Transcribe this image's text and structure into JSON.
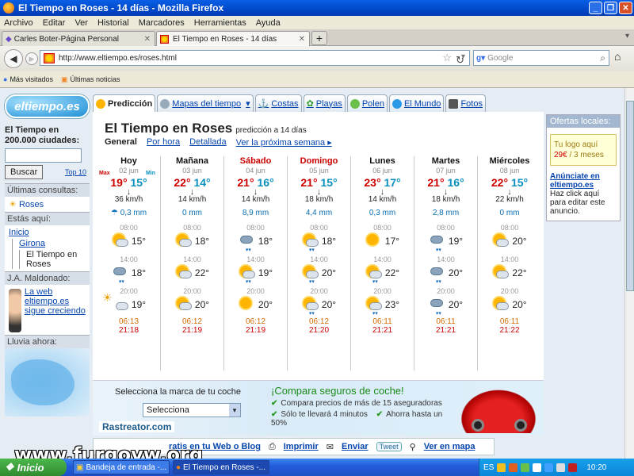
{
  "window": {
    "title": "El Tiempo en Roses - 14 días - Mozilla Firefox"
  },
  "menu": [
    "Archivo",
    "Editar",
    "Ver",
    "Historial",
    "Marcadores",
    "Herramientas",
    "Ayuda"
  ],
  "tabs": [
    {
      "label": "Carles Boter-Página Personal"
    },
    {
      "label": "El Tiempo en Roses - 14 días"
    }
  ],
  "url": "http://www.eltiempo.es/roses.html",
  "search": {
    "placeholder": "Google"
  },
  "bookmarks": [
    "Más visitados",
    "Últimas noticias"
  ],
  "left": {
    "logo": "eltiempo.es",
    "search_title": "El Tiempo en 200.000 ciudades:",
    "search_button": "Buscar",
    "top10": "Top 10",
    "recent_title": "Últimas consultas:",
    "recent_item": "Roses",
    "here_title": "Estás aquí:",
    "crumbs": [
      "Inicio",
      "Girona",
      "El Tiempo en Roses"
    ],
    "author_title": "J.A. Maldonado:",
    "author_link": "La web eltiempo.es sigue creciendo",
    "rain_title": "Lluvia ahora:"
  },
  "site_tabs": [
    "Predicción",
    "Mapas del tiempo",
    "Costas",
    "Playas",
    "Polen",
    "El Mundo",
    "Fotos"
  ],
  "heading": {
    "title": "El Tiempo en Roses",
    "sub": "predicción a 14 días"
  },
  "subnav": {
    "current": "General",
    "links": [
      "Por hora",
      "Detallada",
      "Ver la próxima semana ▸"
    ]
  },
  "labels": {
    "max": "Max",
    "min": "Min"
  },
  "days": [
    {
      "name": "Hoy",
      "date": "02 jun",
      "max": "19°",
      "min": "15°",
      "wind": "36 km/h",
      "rain": "0,3 mm",
      "slots": [
        {
          "time": "08:00",
          "temp": "15°",
          "icon": "sun-cloud-icon"
        },
        {
          "time": "14:00",
          "temp": "18°",
          "icon": "rain-cloud-icon"
        },
        {
          "time": "20:00",
          "temp": "19°",
          "icon": "cloud-icon"
        }
      ],
      "sunrise": "06:13",
      "sunset": "21:18"
    },
    {
      "name": "Mañana",
      "date": "03 jun",
      "max": "22°",
      "min": "14°",
      "wind": "14 km/h",
      "rain": "0 mm",
      "slots": [
        {
          "time": "08:00",
          "temp": "18°",
          "icon": "sun-cloud-icon"
        },
        {
          "time": "14:00",
          "temp": "22°",
          "icon": "sun-cloud-icon"
        },
        {
          "time": "20:00",
          "temp": "20°",
          "icon": "sun-cloud-icon"
        }
      ],
      "sunrise": "06:12",
      "sunset": "21:19"
    },
    {
      "name": "Sábado",
      "date": "04 jun",
      "max": "21°",
      "min": "16°",
      "wind": "14 km/h",
      "rain": "8,9 mm",
      "slots": [
        {
          "time": "08:00",
          "temp": "18°",
          "icon": "rain-cloud-icon"
        },
        {
          "time": "14:00",
          "temp": "19°",
          "icon": "sun-rain-icon"
        },
        {
          "time": "20:00",
          "temp": "20°",
          "icon": "sun-icon"
        }
      ],
      "sunrise": "06:12",
      "sunset": "21:19",
      "red": true
    },
    {
      "name": "Domingo",
      "date": "05 jun",
      "max": "21°",
      "min": "15°",
      "wind": "18 km/h",
      "rain": "4,4 mm",
      "slots": [
        {
          "time": "08:00",
          "temp": "18°",
          "icon": "sun-rain-icon"
        },
        {
          "time": "14:00",
          "temp": "20°",
          "icon": "sun-rain-icon"
        },
        {
          "time": "20:00",
          "temp": "20°",
          "icon": "sun-rain-icon"
        }
      ],
      "sunrise": "06:12",
      "sunset": "21:20",
      "red": true
    },
    {
      "name": "Lunes",
      "date": "06 jun",
      "max": "23°",
      "min": "17°",
      "wind": "14 km/h",
      "rain": "0,3 mm",
      "slots": [
        {
          "time": "08:00",
          "temp": "17°",
          "icon": "sun-icon"
        },
        {
          "time": "14:00",
          "temp": "22°",
          "icon": "sun-rain-icon"
        },
        {
          "time": "20:00",
          "temp": "23°",
          "icon": "sun-rain-icon"
        }
      ],
      "sunrise": "06:11",
      "sunset": "21:21"
    },
    {
      "name": "Martes",
      "date": "07 jun",
      "max": "21°",
      "min": "16°",
      "wind": "18 km/h",
      "rain": "2,8 mm",
      "slots": [
        {
          "time": "08:00",
          "temp": "19°",
          "icon": "rain-cloud-icon"
        },
        {
          "time": "14:00",
          "temp": "20°",
          "icon": "rain-cloud-icon"
        },
        {
          "time": "20:00",
          "temp": "20°",
          "icon": "rain-cloud-icon"
        }
      ],
      "sunrise": "06:11",
      "sunset": "21:21"
    },
    {
      "name": "Miércoles",
      "date": "08 jun",
      "max": "22°",
      "min": "15°",
      "wind": "22 km/h",
      "rain": "0 mm",
      "slots": [
        {
          "time": "08:00",
          "temp": "20°",
          "icon": "sun-cloud-icon"
        },
        {
          "time": "14:00",
          "temp": "22°",
          "icon": "sun-cloud-icon"
        },
        {
          "time": "20:00",
          "temp": "20°",
          "icon": "sun-cloud-icon"
        }
      ],
      "sunrise": "06:11",
      "sunset": "21:22"
    }
  ],
  "ad": {
    "select_title": "Selecciona la marca de tu coche",
    "select_value": "Selecciona",
    "brand": "Rastreator.com",
    "headline": "¡Compara seguros de coche!",
    "lines": [
      "Compara precios de más de 15 aseguradoras",
      "Sólo te llevará 4 minutos",
      "Ahorra hasta un 50%"
    ]
  },
  "share": {
    "web": "ratis en tu Web o Blog",
    "print": "Imprimir",
    "send": "Enviar",
    "tweet": "Tweet",
    "map": "Ver en mapa"
  },
  "right": {
    "title": "Ofertas locales:",
    "logo_text": "Tu logo aquí",
    "price": "29€",
    "period": " / 3 meses",
    "link": "Anúnciate en eltiempo.es",
    "desc": "Haz click aquí para editar este anuncio."
  },
  "watermark": "www.furgovw.org",
  "taskbar": {
    "start": "Inicio",
    "items": [
      "Bandeja de entrada -...",
      "El Tiempo en Roses -..."
    ],
    "lang": "ES",
    "clock": "10:20"
  }
}
